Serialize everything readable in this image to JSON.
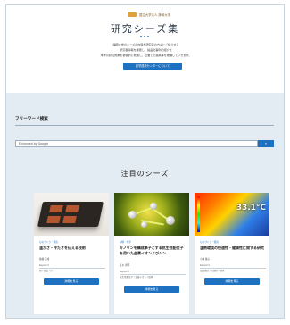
{
  "hero": {
    "logo_text": "国立大学法人 静岡大学",
    "title": "研究シーズ集",
    "intro": [
      "静岡大学のシーズの内容を研究者の方々にご紹介する",
      "研究者情報を検索し、製品化事例の紹介を",
      "本学の研究成果を積極的に発信し、企業との連携等を推進していきます。"
    ],
    "button_label": "産学連携センターについて"
  },
  "search": {
    "heading": "フリーワード検索",
    "placeholder": "Enhanced by Google",
    "button_icon": "search-icon"
  },
  "featured": {
    "title": "注目のシーズ",
    "cards": [
      {
        "tag": "ものづくり・環境",
        "title": "温かさ・冷たさを伝える技術",
        "author": "佐藤 善成",
        "keyword_label": "Keyword",
        "keywords": "熱 / 温度 / 冷",
        "button": "詳細を見る"
      },
      {
        "tag": "材料・化学",
        "title": "キノリンを構成単子とする抗生性配位子を用いた金属イオンよびシン…",
        "author": "五木 秀明",
        "keyword_label": "Keyword",
        "keywords": "抗生性配位子 / 金属イオン / 錯体",
        "button": "詳細を見る"
      },
      {
        "tag": "ものづくり・環境",
        "title": "温熱環境の快適性・健康性に関する研究",
        "author": "小林 俊子",
        "keyword_label": "Keyword",
        "keywords": "温熱環境 / 快適性 / 健康",
        "button": "詳細を見る",
        "image_temp": "33.1°C"
      }
    ]
  }
}
